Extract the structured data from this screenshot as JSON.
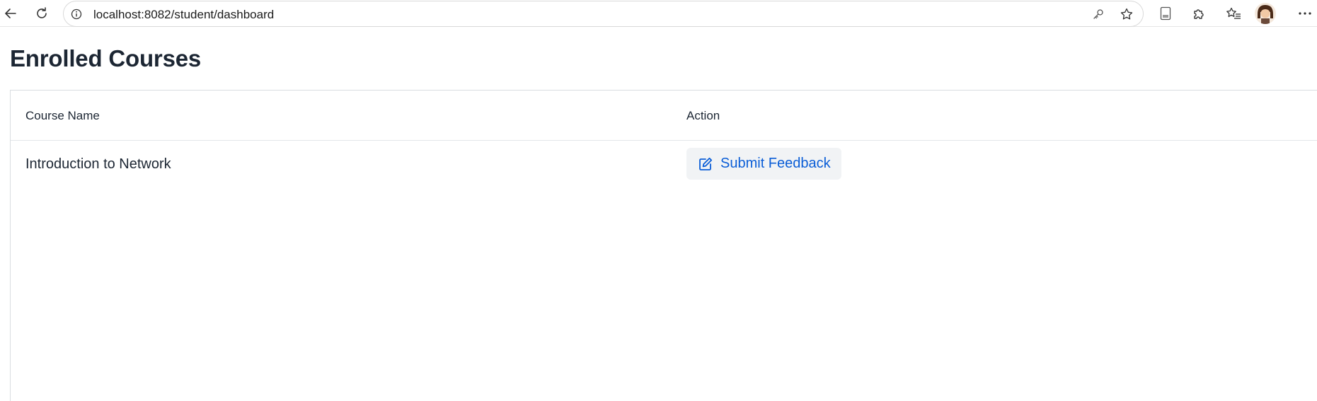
{
  "browser": {
    "url": "localhost:8082/student/dashboard",
    "icons": {
      "back": "back-arrow-icon",
      "refresh": "refresh-icon",
      "site_info": "info-icon",
      "password": "key-icon",
      "favorite": "star-icon",
      "reading_view": "document-icon",
      "extensions": "puzzle-icon",
      "favorites_list": "favorites-icon",
      "profile": "avatar",
      "more": "more-icon"
    }
  },
  "page": {
    "title": "Enrolled Courses"
  },
  "table": {
    "columns": [
      "Course Name",
      "Action"
    ],
    "rows": [
      {
        "course_name": "Introduction to Network",
        "action_label": "Submit Feedback"
      }
    ]
  },
  "colors": {
    "heading": "#1c2633",
    "button_text": "#0b5ed7",
    "button_bg": "#f1f3f5",
    "border": "#d9dde1"
  }
}
